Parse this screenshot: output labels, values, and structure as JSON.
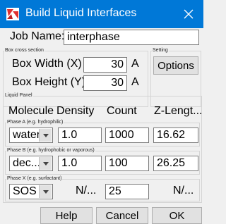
{
  "window": {
    "title": "Build Liquid Interfaces"
  },
  "job": {
    "label": "Job Name:",
    "value": "interphase"
  },
  "box": {
    "group_label": "Box cross section",
    "width_label": "Box Width (X)",
    "width_value": "30",
    "width_unit": "A",
    "height_label": "Box Height (Y)",
    "height_value": "30",
    "height_unit": "A"
  },
  "setting": {
    "group_label": "Setting",
    "options_label": "Options"
  },
  "liquid": {
    "group_label": "Liquid Panel",
    "headers": [
      "Molecule",
      "Density",
      "Count",
      "Z-Lengt..."
    ],
    "phase_a": {
      "label": "Phase A (e.g. hydrophilic)",
      "molecule": "water",
      "density": "1.0",
      "count": "1000",
      "zlength": "16.62"
    },
    "phase_b": {
      "label": "Phase B (e.g. hydrophobic or vaporous)",
      "molecule": "dec...",
      "density": "1.0",
      "count": "100",
      "zlength": "26.25"
    },
    "phase_x": {
      "label": "Phase X (e.g. surfactant)",
      "molecule": "SOS",
      "density": "N/...",
      "count": "25",
      "zlength": "N/..."
    }
  },
  "buttons": {
    "help": "Help",
    "cancel": "Cancel",
    "ok": "OK"
  }
}
